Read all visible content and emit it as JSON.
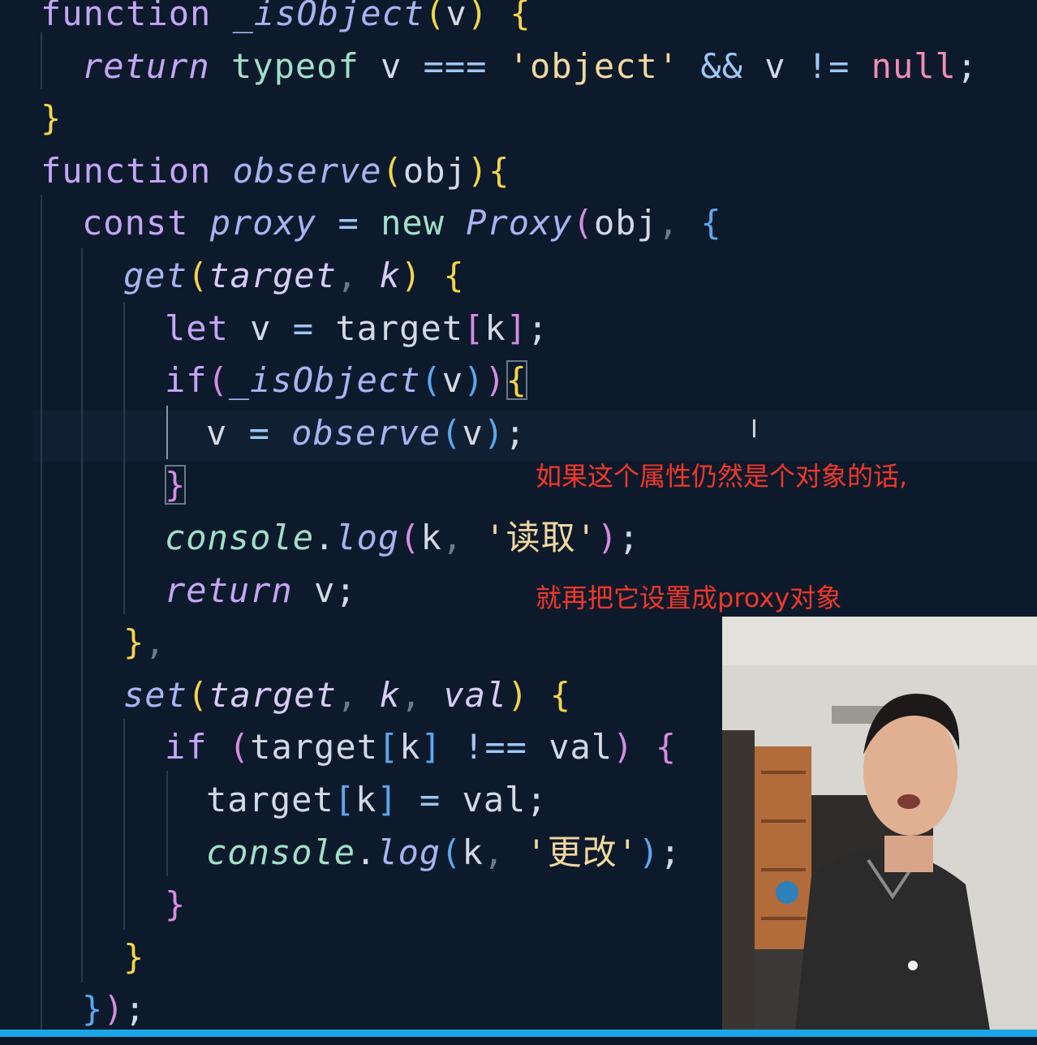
{
  "editor": {
    "lines": [
      {
        "indent": 0,
        "tokens": [
          [
            "function",
            "tok-plain-kw"
          ],
          [
            " ",
            ""
          ],
          [
            "_isObject",
            "tok-fn"
          ],
          [
            "(",
            "tok-p1"
          ],
          [
            "v",
            "tok-var"
          ],
          [
            ")",
            "tok-p1"
          ],
          [
            " ",
            ""
          ],
          [
            "{",
            "tok-p1"
          ]
        ]
      },
      {
        "indent": 1,
        "tokens": [
          [
            "return",
            "tok-kw"
          ],
          [
            " ",
            ""
          ],
          [
            "typeof",
            "tok-type"
          ],
          [
            " v ",
            "tok-var"
          ],
          [
            "===",
            "tok-op"
          ],
          [
            " ",
            ""
          ],
          [
            "'object'",
            "tok-str"
          ],
          [
            " ",
            ""
          ],
          [
            "&&",
            "tok-op"
          ],
          [
            " v ",
            "tok-var"
          ],
          [
            "!=",
            "tok-op"
          ],
          [
            " ",
            ""
          ],
          [
            "null",
            "tok-null"
          ],
          [
            ";",
            "tok-var"
          ]
        ]
      },
      {
        "indent": 0,
        "tokens": [
          [
            "}",
            "tok-p1"
          ]
        ]
      },
      {
        "indent": 0,
        "tokens": [
          [
            "function",
            "tok-plain-kw"
          ],
          [
            " ",
            ""
          ],
          [
            "observe",
            "tok-fn"
          ],
          [
            "(",
            "tok-p1"
          ],
          [
            "obj",
            "tok-var"
          ],
          [
            ")",
            "tok-p1"
          ],
          [
            "{",
            "tok-p1"
          ]
        ]
      },
      {
        "indent": 1,
        "tokens": [
          [
            "const",
            "tok-plain-kw"
          ],
          [
            " ",
            ""
          ],
          [
            "proxy",
            "tok-fn"
          ],
          [
            " ",
            ""
          ],
          [
            "=",
            "tok-op"
          ],
          [
            " ",
            ""
          ],
          [
            "new",
            "tok-type"
          ],
          [
            " ",
            ""
          ],
          [
            "Proxy",
            "tok-fn"
          ],
          [
            "(",
            "tok-p2"
          ],
          [
            "obj",
            "tok-var"
          ],
          [
            ", ",
            "tok-comma"
          ],
          [
            "{",
            "tok-p3"
          ]
        ]
      },
      {
        "indent": 2,
        "tokens": [
          [
            "get",
            "tok-fn"
          ],
          [
            "(",
            "tok-p1"
          ],
          [
            "target",
            "tok-param"
          ],
          [
            ", ",
            "tok-comma"
          ],
          [
            "k",
            "tok-param"
          ],
          [
            ")",
            "tok-p1"
          ],
          [
            " ",
            ""
          ],
          [
            "{",
            "tok-p1"
          ]
        ]
      },
      {
        "indent": 3,
        "tokens": [
          [
            "let",
            "tok-plain-kw"
          ],
          [
            " v ",
            "tok-var"
          ],
          [
            "=",
            "tok-op"
          ],
          [
            " target",
            "tok-var"
          ],
          [
            "[",
            "tok-p2"
          ],
          [
            "k",
            "tok-var"
          ],
          [
            "]",
            "tok-p2"
          ],
          [
            ";",
            "tok-var"
          ]
        ]
      },
      {
        "indent": 3,
        "tokens": [
          [
            "if",
            "tok-plain-kw"
          ],
          [
            "(",
            "tok-p2"
          ],
          [
            "_isObject",
            "tok-fn"
          ],
          [
            "(",
            "tok-p3"
          ],
          [
            "v",
            "tok-var"
          ],
          [
            ")",
            "tok-p3"
          ],
          [
            ")",
            "tok-p2"
          ],
          [
            "{",
            "tok-p1 bracket-box"
          ]
        ]
      },
      {
        "indent": 4,
        "tokens": [
          [
            "v ",
            "tok-var"
          ],
          [
            "=",
            "tok-op"
          ],
          [
            " ",
            ""
          ],
          [
            "observe",
            "tok-fn"
          ],
          [
            "(",
            "tok-p3"
          ],
          [
            "v",
            "tok-var"
          ],
          [
            ")",
            "tok-p3"
          ],
          [
            ";",
            "tok-var"
          ]
        ]
      },
      {
        "indent": 3,
        "tokens": [
          [
            "}",
            "tok-p2 bracket-box"
          ]
        ]
      },
      {
        "indent": 3,
        "tokens": [
          [
            "console",
            "tok-log"
          ],
          [
            ".",
            "tok-var"
          ],
          [
            "log",
            "tok-fn"
          ],
          [
            "(",
            "tok-p2"
          ],
          [
            "k",
            "tok-var"
          ],
          [
            ", ",
            "tok-comma"
          ],
          [
            "'读取'",
            "tok-str"
          ],
          [
            ")",
            "tok-p2"
          ],
          [
            ";",
            "tok-var"
          ]
        ]
      },
      {
        "indent": 3,
        "tokens": [
          [
            "return",
            "tok-kw"
          ],
          [
            " v;",
            "tok-var"
          ]
        ]
      },
      {
        "indent": 2,
        "tokens": [
          [
            "}",
            "tok-p1"
          ],
          [
            ",",
            "tok-comma"
          ]
        ]
      },
      {
        "indent": 2,
        "tokens": [
          [
            "set",
            "tok-fn"
          ],
          [
            "(",
            "tok-p1"
          ],
          [
            "target",
            "tok-param"
          ],
          [
            ", ",
            "tok-comma"
          ],
          [
            "k",
            "tok-param"
          ],
          [
            ", ",
            "tok-comma"
          ],
          [
            "val",
            "tok-param"
          ],
          [
            ")",
            "tok-p1"
          ],
          [
            " ",
            ""
          ],
          [
            "{",
            "tok-p1"
          ]
        ]
      },
      {
        "indent": 3,
        "tokens": [
          [
            "if",
            "tok-plain-kw"
          ],
          [
            " ",
            ""
          ],
          [
            "(",
            "tok-p2"
          ],
          [
            "target",
            "tok-var"
          ],
          [
            "[",
            "tok-p3"
          ],
          [
            "k",
            "tok-var"
          ],
          [
            "]",
            "tok-p3"
          ],
          [
            " ",
            ""
          ],
          [
            "!==",
            "tok-op"
          ],
          [
            " val",
            "tok-var"
          ],
          [
            ")",
            "tok-p2"
          ],
          [
            " ",
            ""
          ],
          [
            "{",
            "tok-p2"
          ]
        ]
      },
      {
        "indent": 4,
        "tokens": [
          [
            "target",
            "tok-var"
          ],
          [
            "[",
            "tok-p3"
          ],
          [
            "k",
            "tok-var"
          ],
          [
            "]",
            "tok-p3"
          ],
          [
            " ",
            ""
          ],
          [
            "=",
            "tok-op"
          ],
          [
            " val;",
            "tok-var"
          ]
        ]
      },
      {
        "indent": 4,
        "tokens": [
          [
            "console",
            "tok-log"
          ],
          [
            ".",
            "tok-var"
          ],
          [
            "log",
            "tok-fn"
          ],
          [
            "(",
            "tok-p3"
          ],
          [
            "k",
            "tok-var"
          ],
          [
            ", ",
            "tok-comma"
          ],
          [
            "'更改'",
            "tok-str"
          ],
          [
            ")",
            "tok-p3"
          ],
          [
            ";",
            "tok-var"
          ]
        ]
      },
      {
        "indent": 3,
        "tokens": [
          [
            "}",
            "tok-p2"
          ]
        ]
      },
      {
        "indent": 2,
        "tokens": [
          [
            "}",
            "tok-p1"
          ]
        ]
      },
      {
        "indent": 1,
        "tokens": [
          [
            "}",
            "tok-p3"
          ],
          [
            ")",
            "tok-p2"
          ],
          [
            ";",
            "tok-var"
          ]
        ]
      }
    ]
  },
  "annotation": {
    "line1": "如果这个属性仍然是个对象的话,",
    "line2": "就再把它设置成proxy对象"
  },
  "colors": {
    "background": "#0d1a2b",
    "annotation": "#f3372a",
    "progress": "#1aa6e6"
  },
  "webcam": {
    "icon": "presenter-video-icon"
  }
}
